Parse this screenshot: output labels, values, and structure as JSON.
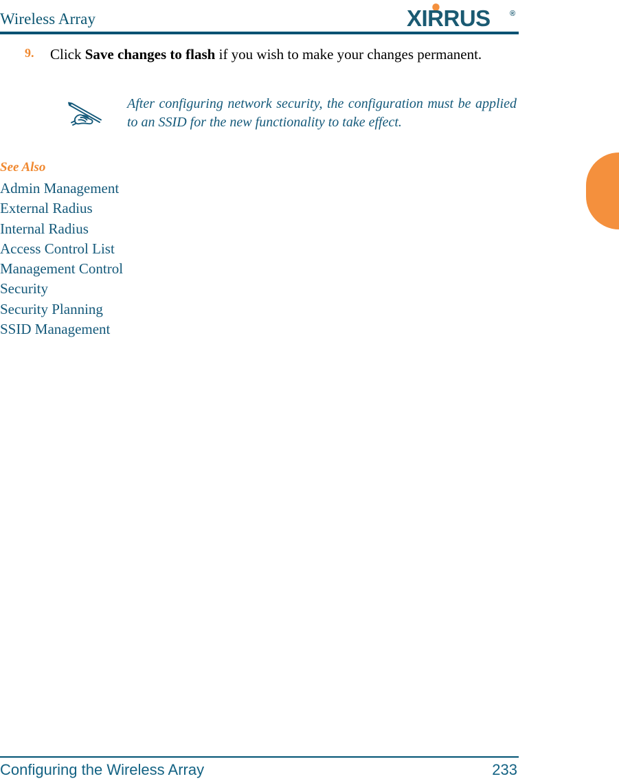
{
  "page": {
    "header": {
      "title": "Wireless Array",
      "logo_text": "XIRRUS",
      "logo_trademark": "®",
      "logo_color": "#1a5a72",
      "logo_dot_color": "#f4903d",
      "rule_color": "#005273"
    },
    "thumb_tab": {
      "name": "page-thumb-tab",
      "color": "#f4903d"
    },
    "step": {
      "number": "9.",
      "number_color": "#f0882f",
      "text_before": "Click ",
      "bold_text": "Save changes to flash",
      "text_after": " if you wish to make your changes permanent."
    },
    "note": {
      "icon": "hand-writing-pen-icon",
      "icon_color": "#14597a",
      "text": "After configuring network security, the configuration must be applied to an SSID for the new functionality to take effect.",
      "text_color": "#14597a"
    },
    "see_also": {
      "heading": "See Also",
      "heading_color": "#f0882f",
      "link_color": "#14597a",
      "links": [
        "Admin Management",
        "External Radius",
        "Internal Radius",
        "Access Control List",
        "Management Control",
        "Security",
        "Security Planning",
        "SSID Management"
      ]
    },
    "footer": {
      "title": "Configuring the Wireless Array",
      "page_number": "233",
      "color": "#136283",
      "rule_color": "#005273"
    }
  }
}
